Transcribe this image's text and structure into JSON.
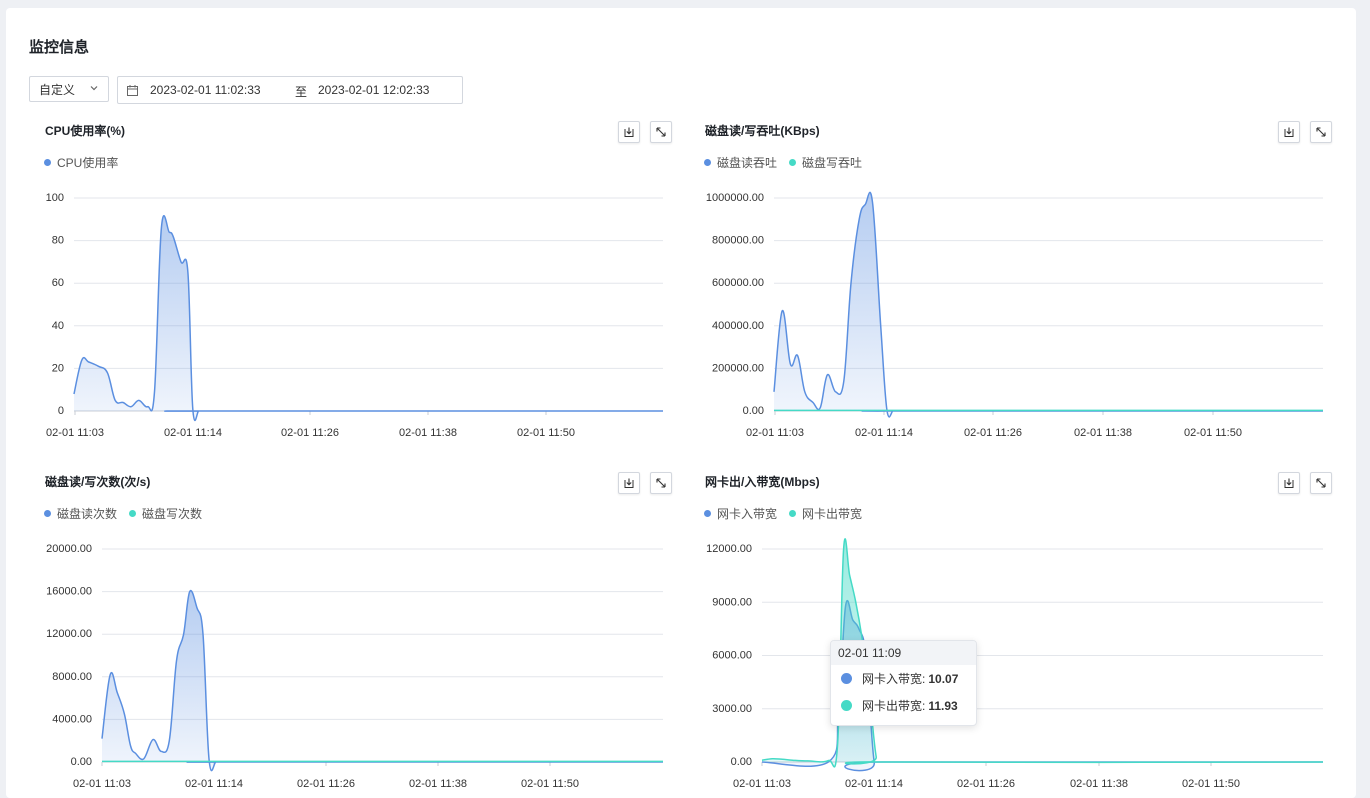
{
  "page": {
    "title": "监控信息"
  },
  "filters": {
    "range_select": "自定义",
    "start_time": "2023-02-01 11:02:33",
    "separator": "至",
    "end_time": "2023-02-01 12:02:33"
  },
  "icons": {
    "download": "download-icon",
    "expand": "expand-icon",
    "calendar": "calendar-icon",
    "chevron": "chevron-down-icon"
  },
  "colors": {
    "series_blue": "#5b8fe0",
    "series_teal": "#45dac6",
    "grid": "#e3e6eb"
  },
  "tooltip": {
    "time": "02-01 11:09",
    "rows": [
      {
        "label": "网卡入带宽:",
        "value": "10.07"
      },
      {
        "label": "网卡出带宽:",
        "value": "11.93"
      }
    ]
  },
  "chart_data": [
    {
      "type": "area",
      "title": "CPU使用率(%)",
      "x_ticks": [
        "02-01 11:03",
        "02-01 11:14",
        "02-01 11:26",
        "02-01 11:38",
        "02-01 11:50"
      ],
      "y_ticks": [
        "0",
        "20",
        "40",
        "60",
        "80",
        "100"
      ],
      "ylim": [
        0,
        100
      ],
      "xlim": [
        0,
        60
      ],
      "grid": true,
      "legend_position": "top-left",
      "series": [
        {
          "name": "CPU使用率",
          "color": "#5b8fe0",
          "x": [
            0,
            0.8,
            1.5,
            2.5,
            3.4,
            4.2,
            5.0,
            5.8,
            6.6,
            7.5,
            8.2,
            8.9,
            9.7,
            10.1,
            10.9,
            11.6,
            12.1,
            12.7,
            13.1,
            60
          ],
          "y": [
            8,
            24,
            23,
            21,
            18,
            5,
            4,
            2,
            5,
            2,
            9,
            86,
            84,
            82,
            70,
            65,
            1,
            0,
            0,
            0
          ]
        }
      ]
    },
    {
      "type": "area",
      "title": "磁盘读/写吞吐(KBps)",
      "x_ticks": [
        "02-01 11:03",
        "02-01 11:14",
        "02-01 11:26",
        "02-01 11:38",
        "02-01 11:50"
      ],
      "y_ticks": [
        "0.00",
        "200000.00",
        "400000.00",
        "600000.00",
        "800000.00",
        "1000000.00"
      ],
      "ylim": [
        0,
        1000000
      ],
      "xlim": [
        0,
        53.5
      ],
      "grid": true,
      "legend_position": "top-left",
      "series": [
        {
          "name": "磁盘读吞吐",
          "color": "#5b8fe0",
          "x": [
            0,
            0.8,
            1.6,
            2.3,
            3.0,
            3.8,
            4.5,
            5.2,
            6.0,
            6.8,
            7.5,
            8.3,
            8.9,
            9.6,
            10.4,
            11.0,
            11.6,
            12.0,
            53.5
          ],
          "y": [
            90000,
            470000,
            220000,
            260000,
            90000,
            40000,
            15000,
            170000,
            90000,
            140000,
            600000,
            900000,
            970000,
            980000,
            400000,
            5000,
            0,
            0,
            0
          ]
        },
        {
          "name": "磁盘写吞吐",
          "color": "#45dac6",
          "x": [
            0,
            53.5
          ],
          "y": [
            3000,
            3000
          ]
        }
      ]
    },
    {
      "type": "area",
      "title": "磁盘读/写次数(次/s)",
      "x_ticks": [
        "02-01 11:03",
        "02-01 11:14",
        "02-01 11:26",
        "02-01 11:38",
        "02-01 11:50"
      ],
      "y_ticks": [
        "0.00",
        "4000.00",
        "8000.00",
        "12000.00",
        "16000.00",
        "20000.00"
      ],
      "ylim": [
        0,
        20000
      ],
      "xlim": [
        0,
        55
      ],
      "grid": true,
      "legend_position": "top-left",
      "series": [
        {
          "name": "磁盘读次数",
          "color": "#5b8fe0",
          "x": [
            0,
            0.8,
            1.5,
            2.2,
            2.8,
            3.3,
            4.1,
            5.0,
            5.8,
            6.6,
            7.3,
            8.0,
            8.6,
            9.3,
            9.9,
            10.5,
            11.2,
            12.0,
            55
          ],
          "y": [
            2200,
            8200,
            6500,
            4500,
            1500,
            800,
            300,
            2100,
            1000,
            2000,
            9500,
            12000,
            16000,
            14500,
            12000,
            200,
            0,
            0,
            0
          ]
        },
        {
          "name": "磁盘写次数",
          "color": "#45dac6",
          "x": [
            0,
            55
          ],
          "y": [
            60,
            60
          ]
        }
      ]
    },
    {
      "type": "area",
      "title": "网卡出/入带宽(Mbps)",
      "x_ticks": [
        "02-01 11:03",
        "02-01 11:14",
        "02-01 11:26",
        "02-01 11:38",
        "02-01 11:50"
      ],
      "y_ticks": [
        "0.00",
        "3000.00",
        "6000.00",
        "9000.00",
        "12000.00"
      ],
      "ylim": [
        0,
        12000
      ],
      "xlim": [
        0,
        55
      ],
      "grid": true,
      "legend_position": "top-left",
      "series": [
        {
          "name": "网卡入带宽",
          "color": "#5b8fe0",
          "x": [
            0,
            6.5,
            7.5,
            8.2,
            8.9,
            9.5,
            10.2,
            11.0,
            11.8,
            55
          ],
          "y": [
            0,
            0,
            3000,
            8800,
            8000,
            7500,
            6000,
            0,
            0,
            0
          ]
        },
        {
          "name": "网卡出带宽",
          "color": "#45dac6",
          "x": [
            0,
            1.0,
            2.0,
            3.0,
            4.5,
            6.5,
            7.4,
            8.0,
            8.6,
            9.2,
            9.8,
            10.5,
            11.2,
            11.8,
            55
          ],
          "y": [
            100,
            180,
            150,
            100,
            60,
            80,
            900,
            12000,
            10500,
            9000,
            7000,
            4000,
            300,
            0,
            0
          ]
        }
      ]
    }
  ]
}
